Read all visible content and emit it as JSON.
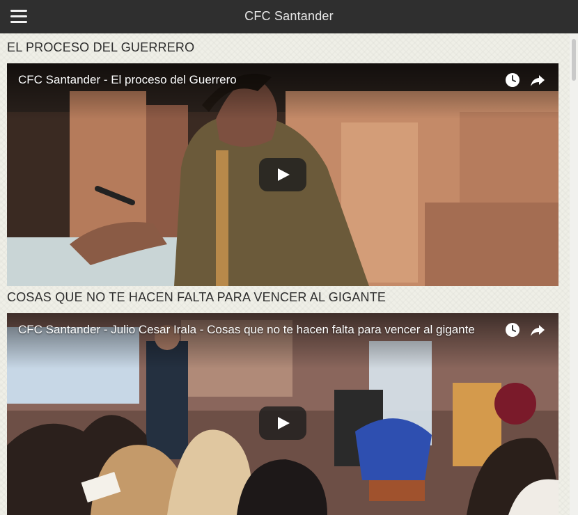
{
  "header": {
    "title": "CFC Santander",
    "menu_icon": "hamburger-menu-icon"
  },
  "sections": [
    {
      "heading": "EL PROCESO DEL GUERRERO",
      "video": {
        "title": "CFC Santander - El proceso del Guerrero",
        "icons": [
          "clock-icon",
          "share-icon",
          "play-icon"
        ]
      }
    },
    {
      "heading": "COSAS QUE NO TE HACEN FALTA PARA VENCER AL GIGANTE",
      "video": {
        "title": "CFC Santander - Julio Cesar Irala - Cosas que no te hacen falta para vencer al gigante",
        "icons": [
          "clock-icon",
          "share-icon",
          "play-icon"
        ]
      }
    }
  ],
  "colors": {
    "header_bg": "#2f2f2f",
    "page_bg": "#efefe7",
    "heading_text": "#2c2c2c"
  }
}
